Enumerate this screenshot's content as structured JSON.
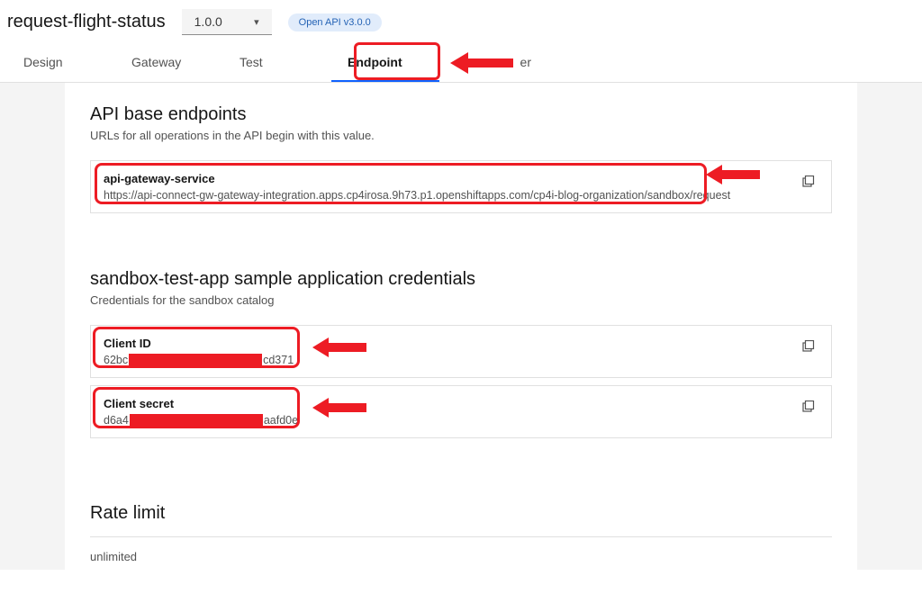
{
  "header": {
    "title": "request-flight-status",
    "version": "1.0.0",
    "badge": "Open API v3.0.0"
  },
  "tabs": {
    "items": [
      "Design",
      "Gateway",
      "Test",
      "Endpoint",
      "er"
    ],
    "activeIndex": 3
  },
  "endpoints": {
    "title": "API base endpoints",
    "desc": "URLs for all operations in the API begin with this value.",
    "gateway": {
      "label": "api-gateway-service",
      "url": "https://api-connect-gw-gateway-integration.apps.cp4irosa.9h73.p1.openshiftapps.com/cp4i-blog-organization/sandbox/request"
    }
  },
  "credentials": {
    "title": "sandbox-test-app sample application credentials",
    "desc": "Credentials for the sandbox catalog",
    "clientId": {
      "label": "Client ID",
      "prefix": "62bc",
      "suffix": "cd371"
    },
    "clientSecret": {
      "label": "Client secret",
      "prefix": "d6a4",
      "suffix": "aafd0e"
    }
  },
  "rate": {
    "title": "Rate limit",
    "value": "unlimited"
  }
}
